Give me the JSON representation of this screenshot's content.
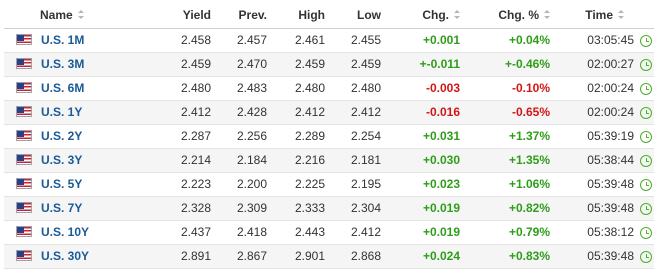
{
  "headers": {
    "name": "Name",
    "yield": "Yield",
    "prev": "Prev.",
    "high": "High",
    "low": "Low",
    "chg": "Chg.",
    "chg_pct": "Chg. %",
    "time": "Time"
  },
  "colors": {
    "positive": "#2e9e19",
    "negative": "#d11616",
    "link": "#1a5a96",
    "clock": "#4caf2a"
  },
  "flag_icon": "us-flag-icon",
  "clock_icon": "clock-icon",
  "rows": [
    {
      "name": "U.S. 1M",
      "yield": "2.458",
      "prev": "2.457",
      "high": "2.461",
      "low": "2.455",
      "chg": "+0.001",
      "chg_pct": "+0.04%",
      "time": "03:05:45",
      "dir": "pos"
    },
    {
      "name": "U.S. 3M",
      "yield": "2.459",
      "prev": "2.470",
      "high": "2.459",
      "low": "2.459",
      "chg": "+-0.011",
      "chg_pct": "+-0.46%",
      "time": "02:00:27",
      "dir": "pos"
    },
    {
      "name": "U.S. 6M",
      "yield": "2.480",
      "prev": "2.483",
      "high": "2.480",
      "low": "2.480",
      "chg": "-0.003",
      "chg_pct": "-0.10%",
      "time": "02:00:24",
      "dir": "neg"
    },
    {
      "name": "U.S. 1Y",
      "yield": "2.412",
      "prev": "2.428",
      "high": "2.412",
      "low": "2.412",
      "chg": "-0.016",
      "chg_pct": "-0.65%",
      "time": "02:00:24",
      "dir": "neg"
    },
    {
      "name": "U.S. 2Y",
      "yield": "2.287",
      "prev": "2.256",
      "high": "2.289",
      "low": "2.254",
      "chg": "+0.031",
      "chg_pct": "+1.37%",
      "time": "05:39:19",
      "dir": "pos"
    },
    {
      "name": "U.S. 3Y",
      "yield": "2.214",
      "prev": "2.184",
      "high": "2.216",
      "low": "2.181",
      "chg": "+0.030",
      "chg_pct": "+1.35%",
      "time": "05:38:44",
      "dir": "pos"
    },
    {
      "name": "U.S. 5Y",
      "yield": "2.223",
      "prev": "2.200",
      "high": "2.225",
      "low": "2.195",
      "chg": "+0.023",
      "chg_pct": "+1.06%",
      "time": "05:39:48",
      "dir": "pos"
    },
    {
      "name": "U.S. 7Y",
      "yield": "2.328",
      "prev": "2.309",
      "high": "2.333",
      "low": "2.304",
      "chg": "+0.019",
      "chg_pct": "+0.82%",
      "time": "05:39:48",
      "dir": "pos"
    },
    {
      "name": "U.S. 10Y",
      "yield": "2.437",
      "prev": "2.418",
      "high": "2.443",
      "low": "2.412",
      "chg": "+0.019",
      "chg_pct": "+0.79%",
      "time": "05:38:12",
      "dir": "pos"
    },
    {
      "name": "U.S. 30Y",
      "yield": "2.891",
      "prev": "2.867",
      "high": "2.901",
      "low": "2.868",
      "chg": "+0.024",
      "chg_pct": "+0.83%",
      "time": "05:39:48",
      "dir": "pos"
    }
  ]
}
